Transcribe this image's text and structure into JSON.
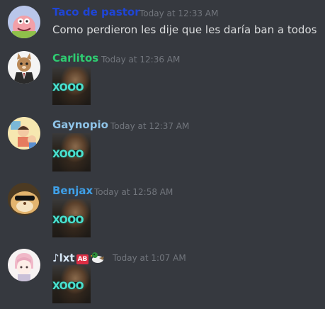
{
  "messages": [
    {
      "username": "Taco de pastor",
      "username_color": "#1f45d6",
      "timestamp": "Today at 12:33 AM",
      "text": "Como perdieron les dije que les daría ban a todos",
      "avatar": "patrick-star-avatar"
    },
    {
      "username": "Carlitos",
      "username_color": "#2ecc71",
      "timestamp": "Today at 12:36 AM",
      "attachment": "XD meme gif",
      "attachment_caption": "XOOO",
      "avatar": "cat-in-suit-avatar"
    },
    {
      "username": "Gaynopio",
      "username_color": "#8fc4e8",
      "timestamp": "Today at 12:37 AM",
      "attachment": "XD meme gif",
      "attachment_caption": "XOOO",
      "avatar": "cartoon-avatar"
    },
    {
      "username": "Benjax",
      "username_color": "#3fa0e8",
      "timestamp": "Today at 12:58 AM",
      "attachment": "XD meme gif",
      "attachment_caption": "XOOO",
      "avatar": "hamster-avatar"
    },
    {
      "username": "♪lxt",
      "username_color": "#d6e6f5",
      "username_badge": "AB",
      "timestamp": "Today at 1:07 AM",
      "attachment": "XD meme gif",
      "attachment_caption": "XOOO",
      "avatar": "anime-boy-avatar"
    }
  ],
  "colors": {
    "background": "#36393f",
    "timestamp": "#72767d",
    "text": "#dcddde"
  }
}
